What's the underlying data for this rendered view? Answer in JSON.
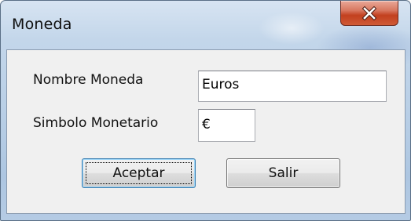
{
  "window": {
    "title": "Moneda"
  },
  "form": {
    "nombre_label": "Nombre Moneda",
    "nombre_value": "Euros",
    "simbolo_label": "Simbolo Monetario",
    "simbolo_value": "€"
  },
  "buttons": {
    "accept_label": "Aceptar",
    "exit_label": "Salir"
  },
  "icons": {
    "close": "close-icon"
  },
  "colors": {
    "close_button": "#c2401f",
    "default_button_border": "#3c7fb1"
  }
}
